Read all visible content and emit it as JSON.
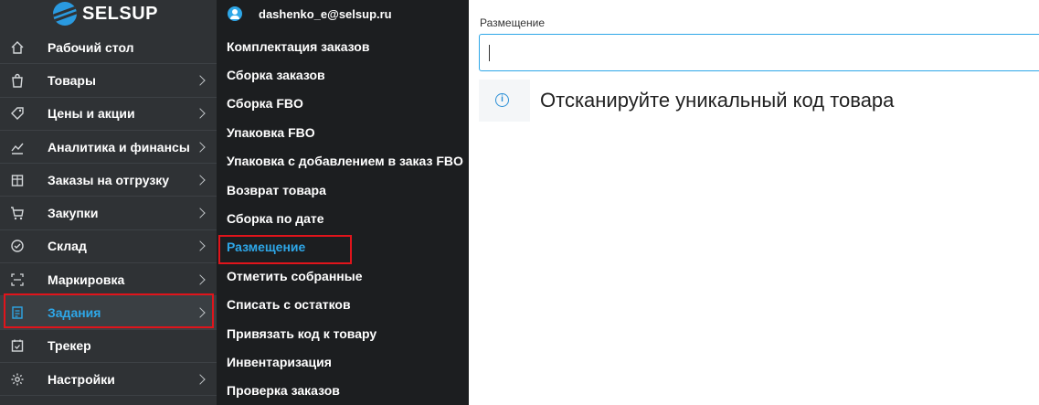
{
  "brand": {
    "name": "SELSUP"
  },
  "user": {
    "email": "dashenko_e@selsup.ru"
  },
  "sidebar": {
    "items": [
      {
        "label": "Рабочий стол",
        "icon": "home-icon",
        "chevron": false
      },
      {
        "label": "Товары",
        "icon": "bag-icon",
        "chevron": true
      },
      {
        "label": "Цены и акции",
        "icon": "tag-icon",
        "chevron": true
      },
      {
        "label": "Аналитика и финансы",
        "icon": "chart-line-icon",
        "chevron": true
      },
      {
        "label": "Заказы на отгрузку",
        "icon": "box-icon",
        "chevron": true
      },
      {
        "label": "Закупки",
        "icon": "cart-icon",
        "chevron": true
      },
      {
        "label": "Склад",
        "icon": "check-circle-icon",
        "chevron": true
      },
      {
        "label": "Маркировка",
        "icon": "scan-icon",
        "chevron": true
      },
      {
        "label": "Задания",
        "icon": "tasks-icon",
        "chevron": true,
        "active": true
      },
      {
        "label": "Трекер",
        "icon": "calendar-check-icon",
        "chevron": false
      },
      {
        "label": "Настройки",
        "icon": "gear-icon",
        "chevron": true
      }
    ]
  },
  "submenu": {
    "items": [
      "Комплектация заказов",
      "Сборка заказов",
      "Сборка FBO",
      "Упаковка FBO",
      "Упаковка с добавлением в заказ FBO",
      "Возврат товара",
      "Сборка по дате",
      "Размещение",
      "Отметить собранные",
      "Списать с остатков",
      "Привязать код к товару",
      "Инвентаризация",
      "Проверка заказов"
    ],
    "active_index": 7
  },
  "main": {
    "field_label": "Размещение",
    "field_value": "",
    "alert_text": "Отсканируйте уникальный код товара",
    "alert_icon": "info-icon"
  },
  "colors": {
    "accent": "#2ea7e8",
    "highlight": "#e0141b",
    "sidebar_bg": "#2f3235",
    "submenu_bg": "#1c1e20"
  }
}
